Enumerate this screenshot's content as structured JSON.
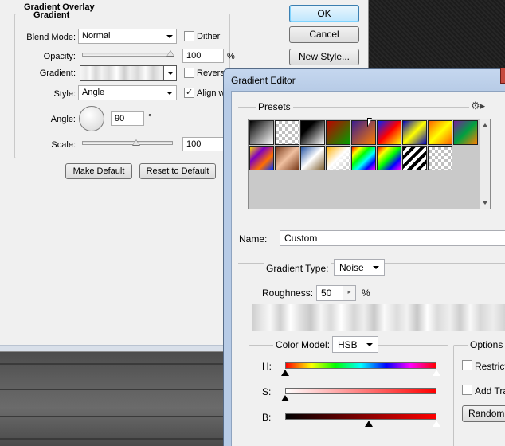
{
  "layer_style": {
    "section_title": "Gradient Overlay",
    "group_title": "Gradient",
    "blend_mode": {
      "label": "Blend Mode:",
      "value": "Normal"
    },
    "dither": {
      "label": "Dither",
      "checked": false
    },
    "opacity": {
      "label": "Opacity:",
      "value": "100",
      "unit": "%"
    },
    "gradient": {
      "label": "Gradient:"
    },
    "reverse": {
      "label": "Reverse",
      "checked": false
    },
    "style": {
      "label": "Style:",
      "value": "Angle"
    },
    "align": {
      "label": "Align wi",
      "checked": true
    },
    "angle": {
      "label": "Angle:",
      "value": "90",
      "unit": "°"
    },
    "scale": {
      "label": "Scale:",
      "value": "100"
    },
    "make_default": "Make Default",
    "reset_default": "Reset to Default",
    "buttons": {
      "ok": "OK",
      "cancel": "Cancel",
      "new_style": "New Style..."
    }
  },
  "gradient_editor": {
    "title": "Gradient Editor",
    "presets_label": "Presets",
    "presets": [
      {
        "name": "black-white",
        "css": "linear-gradient(135deg,#000,#fff)"
      },
      {
        "name": "transparent-checker",
        "css": "checker"
      },
      {
        "name": "black-to-white",
        "css": "linear-gradient(135deg,#000 30%,#fff)"
      },
      {
        "name": "red-green",
        "css": "linear-gradient(135deg,#c00000,#00a000)"
      },
      {
        "name": "violet-orange",
        "css": "linear-gradient(135deg,#3b1d8f,#ff7f00)"
      },
      {
        "name": "blue-red-yellow",
        "css": "linear-gradient(135deg,#0020ff,#ff0000,#ffff00)"
      },
      {
        "name": "blue-yellow-blue",
        "css": "linear-gradient(135deg,#0000c0,#ffff00,#0000c0)"
      },
      {
        "name": "orange-yellow-orange",
        "css": "linear-gradient(135deg,#ff6000,#ffff00,#ff6000)"
      },
      {
        "name": "violet-green-orange",
        "css": "linear-gradient(135deg,#7a1aa0,#00a040,#ff8000)"
      },
      {
        "name": "yellow-violet-orange-blue",
        "css": "linear-gradient(135deg,#ffe000,#8000c0,#ff7000,#0030ff)"
      },
      {
        "name": "copper",
        "css": "linear-gradient(135deg,#7a3a1a,#f0c0a0,#7a3a1a)"
      },
      {
        "name": "chrome",
        "css": "linear-gradient(135deg,#2050a0,#ffffff,#806030)"
      },
      {
        "name": "yellow-white-transparent",
        "css": "linear-gradient(135deg,#ffb000,#fff,transparent)"
      },
      {
        "name": "spectrum",
        "css": "linear-gradient(135deg,#ff0000,#ffff00,#00ff00,#00ffff,#0000ff,#ff00ff)"
      },
      {
        "name": "transparent-rainbow",
        "css": "linear-gradient(135deg,#ff0000,#ffff00,#00ff00,#0000ff,#ff00ff)"
      },
      {
        "name": "transparent-stripes",
        "css": "stripes"
      },
      {
        "name": "transparent",
        "css": "checker"
      }
    ],
    "name_label": "Name:",
    "name_value": "Custom",
    "gradient_type": {
      "label": "Gradient Type:",
      "value": "Noise"
    },
    "roughness": {
      "label": "Roughness:",
      "value": "50",
      "unit": "%",
      "fraction": 0.5
    },
    "color_model": {
      "label": "Color Model:",
      "value": "HSB"
    },
    "channels": [
      {
        "label": "H:",
        "bar": "hue",
        "stops": [
          0.0,
          1.0
        ]
      },
      {
        "label": "S:",
        "bar": "saturation",
        "stops": [
          0.0
        ]
      },
      {
        "label": "B:",
        "bar": "brightness",
        "stops": [
          0.55,
          1.0
        ]
      }
    ],
    "options": {
      "title": "Options",
      "restrict_label": "Restrict",
      "add_transparency_label": "Add Tra",
      "randomize": "Random"
    }
  }
}
